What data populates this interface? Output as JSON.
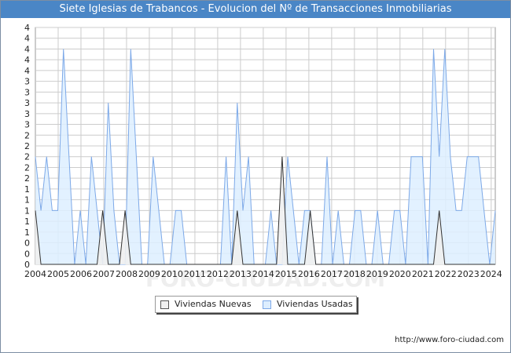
{
  "title": "Siete Iglesias de Trabancos - Evolucion del Nº de Transacciones Inmobiliarias",
  "footer_url": "http://www.foro-ciudad.com",
  "watermark": "FORO-CIUDAD.COM",
  "colors": {
    "title_bg": "#4a86c6",
    "usadas_fill": "#ddeeff",
    "usadas_line": "#7da9e8",
    "nuevas_fill": "#f0f0f0",
    "nuevas_line": "#333333",
    "grid": "#cccccc"
  },
  "chart_data": {
    "type": "area",
    "x_labels": [
      "2004",
      "2005",
      "2006",
      "2007",
      "2008",
      "2009",
      "2010",
      "2011",
      "2012",
      "2013",
      "2014",
      "2015",
      "2016",
      "2017",
      "2018",
      "2019",
      "2020",
      "2021",
      "2022",
      "2023",
      "2024"
    ],
    "y_tick_labels": [
      "0",
      "0",
      "0",
      "1",
      "1",
      "1",
      "1",
      "1",
      "2",
      "2",
      "2",
      "2",
      "2",
      "3",
      "3",
      "3",
      "3",
      "3",
      "4",
      "4",
      "4",
      "4",
      "4"
    ],
    "ylim": [
      0,
      4.4
    ],
    "grid": true,
    "legend_position": "bottom",
    "series": [
      {
        "name": "Viviendas Usadas",
        "values": [
          2,
          1,
          2,
          1,
          1,
          4,
          2,
          0,
          1,
          0,
          2,
          1,
          0,
          3,
          1,
          0,
          0,
          4,
          2,
          0,
          0,
          2,
          1,
          0,
          0,
          1,
          1,
          0,
          0,
          0,
          0,
          0,
          0,
          0,
          2,
          0,
          3,
          1,
          2,
          0,
          0,
          0,
          1,
          0,
          0,
          2,
          1,
          0,
          1,
          1,
          0,
          0,
          2,
          0,
          1,
          0,
          0,
          1,
          1,
          0,
          0,
          1,
          0,
          0,
          1,
          1,
          0,
          2,
          2,
          2,
          0,
          4,
          2,
          4,
          2,
          1,
          1,
          2,
          2,
          2,
          1,
          0,
          1
        ]
      },
      {
        "name": "Viviendas Nuevas",
        "values": [
          1,
          0,
          0,
          0,
          0,
          0,
          0,
          0,
          0,
          0,
          0,
          0,
          1,
          0,
          0,
          0,
          1,
          0,
          0,
          0,
          0,
          0,
          0,
          0,
          0,
          0,
          0,
          0,
          0,
          0,
          0,
          0,
          0,
          0,
          0,
          0,
          1,
          0,
          0,
          0,
          0,
          0,
          0,
          0,
          2,
          0,
          0,
          0,
          0,
          1,
          0,
          0,
          0,
          0,
          0,
          0,
          0,
          0,
          0,
          0,
          0,
          0,
          0,
          0,
          0,
          0,
          0,
          0,
          0,
          0,
          0,
          0,
          1,
          0,
          0,
          0,
          0,
          0,
          0,
          0,
          0,
          0,
          0
        ]
      }
    ]
  }
}
